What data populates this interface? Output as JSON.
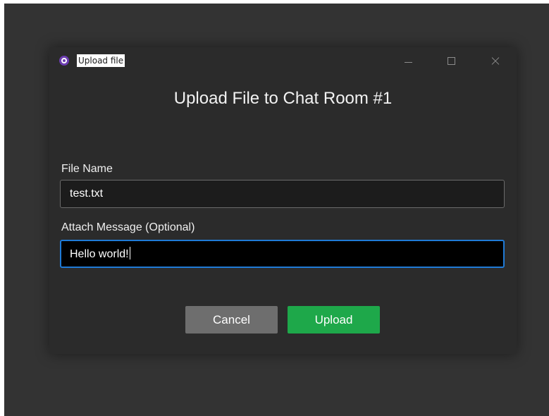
{
  "window": {
    "title": "Upload file",
    "controls": {
      "minimize": "minimize-icon",
      "maximize": "maximize-icon",
      "close": "close-icon"
    }
  },
  "dialog": {
    "heading": "Upload File to Chat Room #1",
    "file_name": {
      "label": "File Name",
      "value": "test.txt"
    },
    "message": {
      "label": "Attach Message (Optional)",
      "value": "Hello world!"
    },
    "buttons": {
      "cancel": "Cancel",
      "upload": "Upload"
    }
  },
  "colors": {
    "background": "#333333",
    "window": "#2b2b2b",
    "focus_border": "#1f7ad6",
    "upload_button": "#1ea84a",
    "cancel_button": "#6e6e6e",
    "app_icon": "#6c3db1"
  }
}
